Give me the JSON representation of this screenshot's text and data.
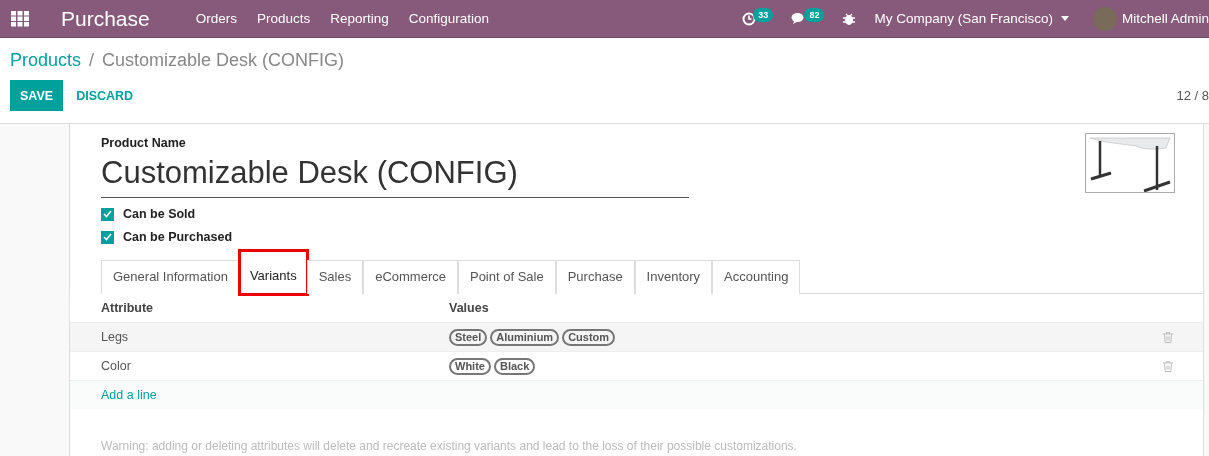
{
  "navbar": {
    "app_name": "Purchase",
    "menu": [
      "Orders",
      "Products",
      "Reporting",
      "Configuration"
    ],
    "activity_count": "33",
    "message_count": "82",
    "company": "My Company (San Francisco)",
    "user": "Mitchell Admin"
  },
  "breadcrumb": {
    "parent": "Products",
    "separator": "/",
    "current": "Customizable Desk (CONFIG)"
  },
  "buttons": {
    "save": "SAVE",
    "discard": "DISCARD"
  },
  "pager": "12 / 8",
  "form": {
    "name_label": "Product Name",
    "name": "Customizable Desk (CONFIG)",
    "options": [
      {
        "label": "Can be Sold",
        "checked": true
      },
      {
        "label": "Can be Purchased",
        "checked": true
      }
    ]
  },
  "tabs": [
    {
      "label": "General Information",
      "selected": false
    },
    {
      "label": "Variants",
      "selected": true
    },
    {
      "label": "Sales",
      "selected": false
    },
    {
      "label": "eCommerce",
      "selected": false
    },
    {
      "label": "Point of Sale",
      "selected": false
    },
    {
      "label": "Purchase",
      "selected": false
    },
    {
      "label": "Inventory",
      "selected": false
    },
    {
      "label": "Accounting",
      "selected": false
    }
  ],
  "table": {
    "columns": [
      "Attribute",
      "Values"
    ],
    "rows": [
      {
        "attribute": "Legs",
        "values": [
          "Steel",
          "Aluminium",
          "Custom"
        ]
      },
      {
        "attribute": "Color",
        "values": [
          "White",
          "Black"
        ]
      }
    ],
    "add_line": "Add a line"
  },
  "warning": "Warning: adding or deleting attributes will delete and recreate existing variants and lead to the loss of their possible customizations."
}
